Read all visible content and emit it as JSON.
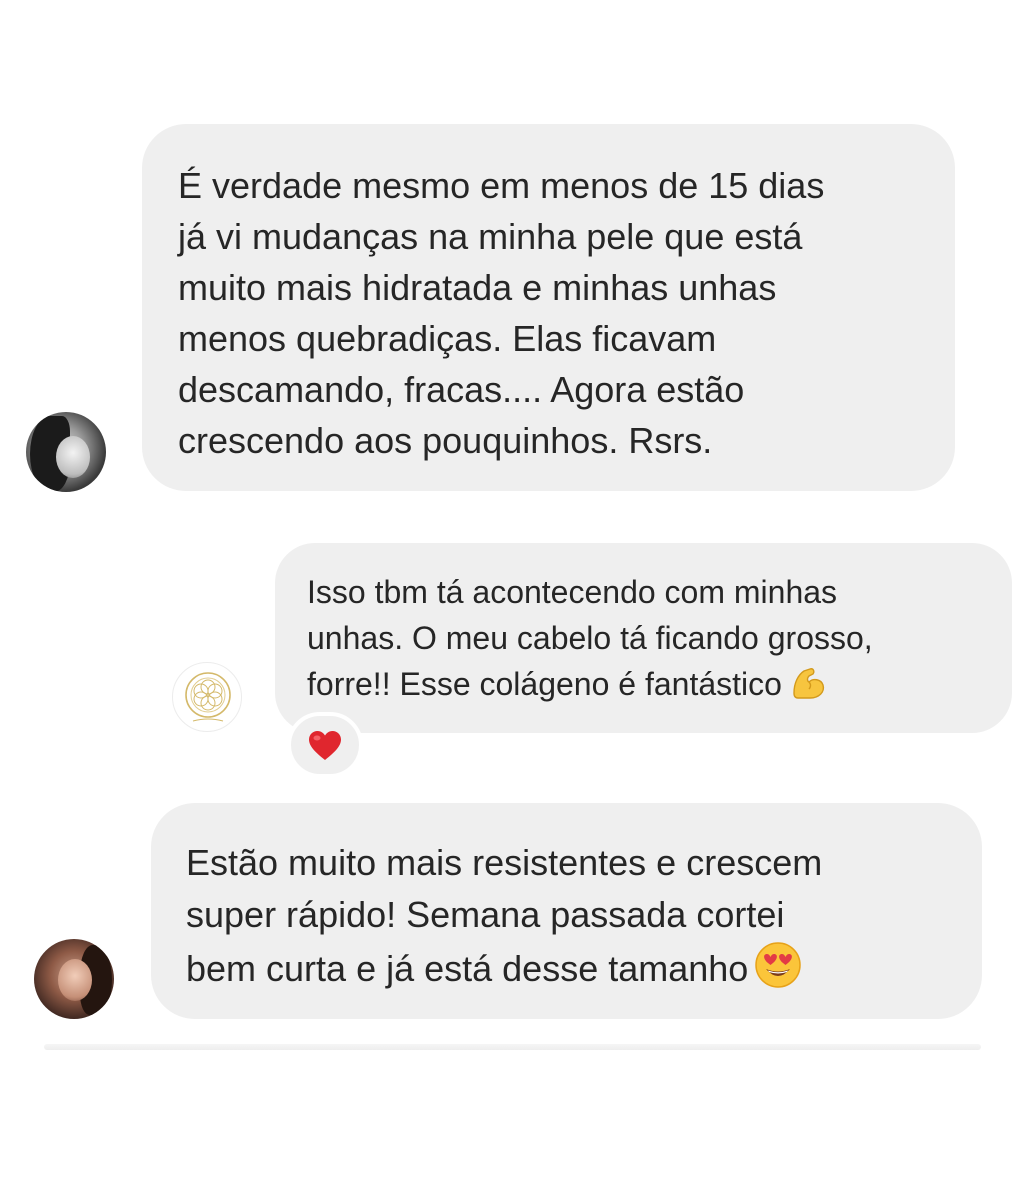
{
  "messages": [
    {
      "text": "É verdade mesmo em menos de 15 dias\njá vi mudanças na minha pele que está\nmuito mais hidratada e minhas unhas\nmenos  quebradiças. Elas ficavam\ndescamando, fracas.... Agora estão\ncrescendo aos pouquinhos.  Rsrs.",
      "avatar": "woman-black-white-photo"
    },
    {
      "text": "Isso tbm tá acontecendo com minhas\nunhas. O meu cabelo tá ficando grosso,\nforre!! Esse colágeno é fantástico",
      "trailing_emoji": "flexed-biceps-emoji",
      "avatar": "gold-mandala-logo",
      "reaction": "red-heart-emoji"
    },
    {
      "text": "Estão muito mais resistentes e crescem\nsuper rápido! Semana passada cortei\nbem curta e já está desse tamanho",
      "trailing_emoji": "heart-eyes-emoji",
      "avatar": "woman-color-photo"
    }
  ],
  "colors": {
    "bubble": "#efefef",
    "text": "#262626",
    "heart": "#e0262e",
    "logo_gold": "#d4b96a"
  }
}
